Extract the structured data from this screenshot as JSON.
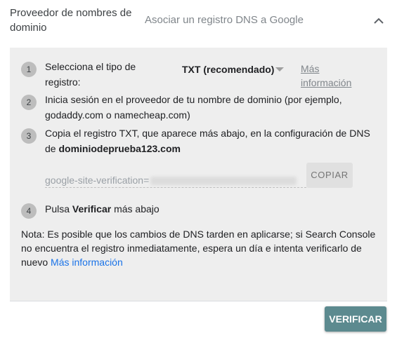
{
  "header": {
    "title": "Proveedor de nombres de dominio",
    "subtitle": "Asociar un registro DNS a Google",
    "collapse_icon": "chevron-up-icon"
  },
  "steps": [
    {
      "number": "1",
      "text": "Selecciona el tipo de registro:"
    },
    {
      "number": "2",
      "text": "Inicia sesión en el proveedor de tu nombre de dominio (por ejemplo, godaddy.com o namecheap.com)"
    },
    {
      "number": "3",
      "text": "Copia el registro TXT, que aparece más abajo, en la configuración de DNS de",
      "domain": "dominiodeprueba123.com"
    },
    {
      "number": "4",
      "text_before": "Pulsa",
      "bold": "Verificar",
      "text_after": "más abajo"
    }
  ],
  "record_type": {
    "selected": "TXT (recomendado)",
    "more_info": "Más información"
  },
  "txt_record": {
    "prefix": "google-site-verification="
  },
  "copy_button": "COPIAR",
  "note": {
    "text": "Nota: Es posible que los cambios de DNS tarden en aplicarse; si Search Console no encuentra el registro inmediatamente, espera un día e intenta verificarlo de nuevo",
    "link": "Más información"
  },
  "verify_button": "VERIFICAR",
  "colors": {
    "link": "#1a73e8",
    "verify_button": "#5c8a8f",
    "panel_background": "#eeeeee"
  }
}
